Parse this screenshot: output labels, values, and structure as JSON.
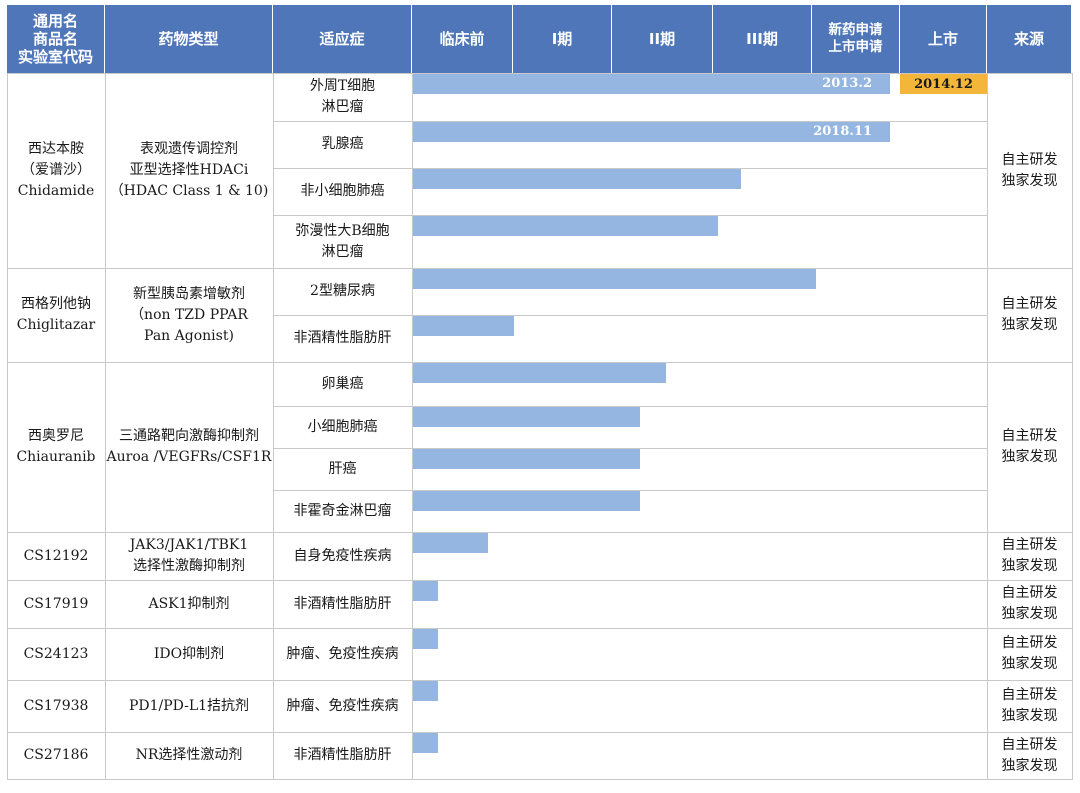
{
  "header": {
    "col_drug": "通用名\n商品名\n实验室代码",
    "col_type": "药物类型",
    "col_indication": "适应症",
    "phases": [
      "临床前",
      "I期",
      "II期",
      "III期",
      "新药申请\n上市申请",
      "上市"
    ],
    "col_source": "来源"
  },
  "rows": [
    {
      "drug": "西达本胺\n（爱谱沙）\nChidamide",
      "type": "表观遗传调控剂\n亚型选择性HDACi\n（HDAC Class 1 & 10)",
      "source": "自主研发\n独家发现",
      "indications": [
        {
          "name": "外周T细胞\n淋巴瘤",
          "progress": 0.83,
          "label": "2013.2",
          "marker": "2014.12"
        },
        {
          "name": "乳腺癌",
          "progress": 0.83,
          "label": "2018.11"
        },
        {
          "name": "非小细胞肺癌",
          "progress": 0.57
        },
        {
          "name": "弥漫性大B细胞\n淋巴瘤",
          "progress": 0.53
        }
      ]
    },
    {
      "drug": "西格列他钠\nChiglitazar",
      "type": "新型胰岛素增敏剂\n（non TZD PPAR\nPan Agonist)",
      "source": "自主研发\n独家发现",
      "indications": [
        {
          "name": "2型糖尿病",
          "progress": 0.7
        },
        {
          "name": "非酒精性脂肪肝",
          "progress": 0.175
        }
      ]
    },
    {
      "drug": "西奥罗尼\nChiauranib",
      "type": "三通路靶向激酶抑制剂\nAuroa /VEGFRs/CSF1R",
      "source": "自主研发\n独家发现",
      "indications": [
        {
          "name": "卵巢癌",
          "progress": 0.44
        },
        {
          "name": "小细胞肺癌",
          "progress": 0.395
        },
        {
          "name": "肝癌",
          "progress": 0.395
        },
        {
          "name": "非霍奇金淋巴瘤",
          "progress": 0.395
        }
      ]
    },
    {
      "drug": "CS12192",
      "type": "JAK3/JAK1/TBK1\n选择性激酶抑制剂",
      "source": "自主研发\n独家发现",
      "indications": [
        {
          "name": "自身免疫性疾病",
          "progress": 0.13
        }
      ]
    },
    {
      "drug": "CS17919",
      "type": "ASK1抑制剂",
      "source": "自主研发\n独家发现",
      "indications": [
        {
          "name": "非酒精性脂肪肝",
          "progress": 0.043
        }
      ]
    },
    {
      "drug": "CS24123",
      "type": "IDO抑制剂",
      "source": "自主研发\n独家发现",
      "indications": [
        {
          "name": "肿瘤、免疫性疾病",
          "progress": 0.043
        }
      ]
    },
    {
      "drug": "CS17938",
      "type": "PD1/PD-L1拮抗剂",
      "source": "自主研发\n独家发现",
      "indications": [
        {
          "name": "肿瘤、免疫性疾病",
          "progress": 0.043
        }
      ]
    },
    {
      "drug": "CS27186",
      "type": "NR选择性激动剂",
      "source": "自主研发\n独家发现",
      "indications": [
        {
          "name": "非酒精性脂肪肝",
          "progress": 0.043
        }
      ]
    }
  ],
  "colors": {
    "header_bg": "#4f76b8",
    "bar": "#94b6e1",
    "marker": "#f4b63a",
    "grid": "#c9c9c9"
  }
}
